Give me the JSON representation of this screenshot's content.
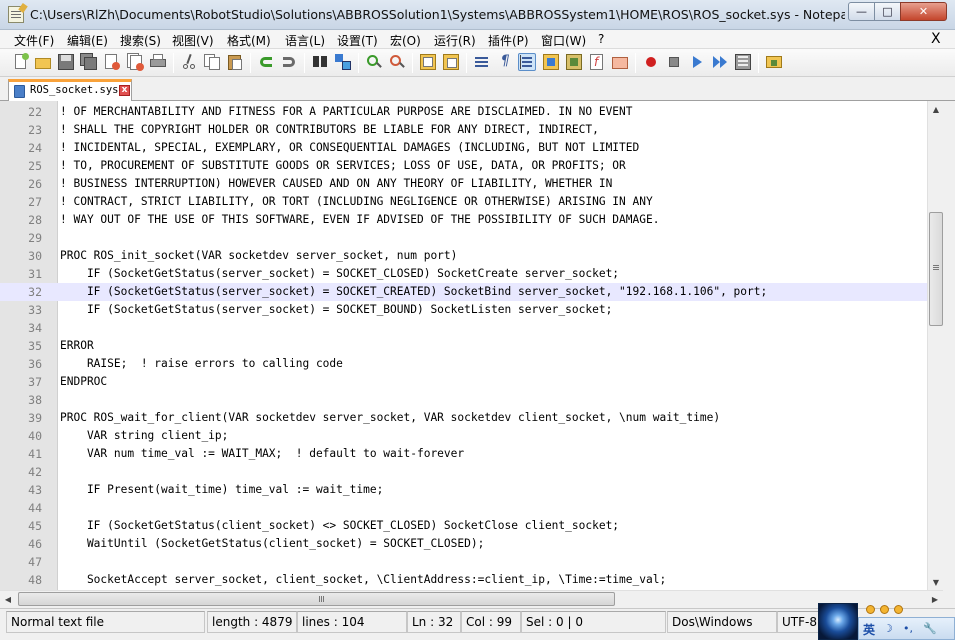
{
  "window": {
    "title": "C:\\Users\\RlZh\\Documents\\RobotStudio\\Solutions\\ABBROSSolution1\\Systems\\ABBROSSystem1\\HOME\\ROS\\ROS_socket.sys - Notepad++ [...",
    "min_glyph": "—",
    "max_glyph": "□",
    "close_glyph": "✕"
  },
  "menu": {
    "items": [
      "文件(F)",
      "编辑(E)",
      "搜索(S)",
      "视图(V)",
      "格式(M)",
      "语言(L)",
      "设置(T)",
      "宏(O)",
      "运行(R)",
      "插件(P)",
      "窗口(W)",
      "?"
    ],
    "close_glyph": "X"
  },
  "toolbar": {
    "icons": [
      "new-file-icon",
      "open-file-icon",
      "save-icon",
      "save-all-icon",
      "close-icon",
      "close-all-icon",
      "print-icon",
      "cut-icon",
      "copy-icon",
      "paste-icon",
      "undo-icon",
      "redo-icon",
      "find-icon",
      "replace-icon",
      "zoom-in-icon",
      "zoom-out-icon",
      "sync-vertical-icon",
      "sync-horizontal-icon",
      "word-wrap-icon",
      "show-all-chars-icon",
      "indent-guide-icon",
      "user-language-icon",
      "document-map-icon",
      "function-list-icon",
      "folder-workspace-icon",
      "record-macro-icon",
      "stop-macro-icon",
      "play-macro-icon",
      "run-macro-multiple-icon",
      "save-macro-icon",
      "plugin-icon"
    ]
  },
  "tab": {
    "label": "ROS_socket.sys",
    "close_glyph": "x"
  },
  "editor": {
    "current_line": 32,
    "lines": [
      {
        "n": "22",
        "text": "! OF MERCHANTABILITY AND FITNESS FOR A PARTICULAR PURPOSE ARE DISCLAIMED. IN NO EVENT"
      },
      {
        "n": "23",
        "text": "! SHALL THE COPYRIGHT HOLDER OR CONTRIBUTORS BE LIABLE FOR ANY DIRECT, INDIRECT,"
      },
      {
        "n": "24",
        "text": "! INCIDENTAL, SPECIAL, EXEMPLARY, OR CONSEQUENTIAL DAMAGES (INCLUDING, BUT NOT LIMITED"
      },
      {
        "n": "25",
        "text": "! TO, PROCUREMENT OF SUBSTITUTE GOODS OR SERVICES; LOSS OF USE, DATA, OR PROFITS; OR"
      },
      {
        "n": "26",
        "text": "! BUSINESS INTERRUPTION) HOWEVER CAUSED AND ON ANY THEORY OF LIABILITY, WHETHER IN"
      },
      {
        "n": "27",
        "text": "! CONTRACT, STRICT LIABILITY, OR TORT (INCLUDING NEGLIGENCE OR OTHERWISE) ARISING IN ANY"
      },
      {
        "n": "28",
        "text": "! WAY OUT OF THE USE OF THIS SOFTWARE, EVEN IF ADVISED OF THE POSSIBILITY OF SUCH DAMAGE."
      },
      {
        "n": "29",
        "text": ""
      },
      {
        "n": "30",
        "text": "PROC ROS_init_socket(VAR socketdev server_socket, num port)"
      },
      {
        "n": "31",
        "text": "    IF (SocketGetStatus(server_socket) = SOCKET_CLOSED) SocketCreate server_socket;"
      },
      {
        "n": "32",
        "text": "    IF (SocketGetStatus(server_socket) = SOCKET_CREATED) SocketBind server_socket, \"192.168.1.106\", port;"
      },
      {
        "n": "33",
        "text": "    IF (SocketGetStatus(server_socket) = SOCKET_BOUND) SocketListen server_socket;"
      },
      {
        "n": "34",
        "text": ""
      },
      {
        "n": "35",
        "text": "ERROR"
      },
      {
        "n": "36",
        "text": "    RAISE;  ! raise errors to calling code"
      },
      {
        "n": "37",
        "text": "ENDPROC"
      },
      {
        "n": "38",
        "text": ""
      },
      {
        "n": "39",
        "text": "PROC ROS_wait_for_client(VAR socketdev server_socket, VAR socketdev client_socket, \\num wait_time)"
      },
      {
        "n": "40",
        "text": "    VAR string client_ip;"
      },
      {
        "n": "41",
        "text": "    VAR num time_val := WAIT_MAX;  ! default to wait-forever"
      },
      {
        "n": "42",
        "text": ""
      },
      {
        "n": "43",
        "text": "    IF Present(wait_time) time_val := wait_time;"
      },
      {
        "n": "44",
        "text": ""
      },
      {
        "n": "45",
        "text": "    IF (SocketGetStatus(client_socket) <> SOCKET_CLOSED) SocketClose client_socket;"
      },
      {
        "n": "46",
        "text": "    WaitUntil (SocketGetStatus(client_socket) = SOCKET_CLOSED);"
      },
      {
        "n": "47",
        "text": ""
      },
      {
        "n": "48",
        "text": "    SocketAccept server_socket, client_socket, \\ClientAddress:=client_ip, \\Time:=time_val;"
      }
    ]
  },
  "scrollbars": {
    "up_glyph": "▲",
    "down_glyph": "▼",
    "left_glyph": "◀",
    "right_glyph": "▶"
  },
  "status": {
    "file_type": "Normal text file",
    "length": "length : 4879",
    "lines": "lines : 104",
    "ln": "Ln : 32",
    "col": "Col : 99",
    "sel": "Sel : 0 | 0",
    "eol": "Dos\\Windows",
    "encoding": "UTF-8"
  },
  "ime": {
    "lang": "英",
    "moon": "☽",
    "punct": "•,",
    "tool": "🔧"
  }
}
